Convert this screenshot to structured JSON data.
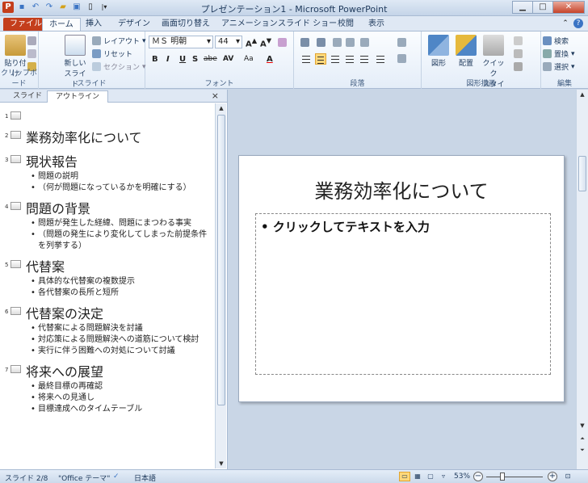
{
  "window": {
    "title": "プレゼンテーション1 - Microsoft PowerPoint",
    "minimize": "▁",
    "maximize": "□",
    "close": "✕"
  },
  "ribbon_tabs": [
    "ファイル",
    "ホーム",
    "挿入",
    "デザイン",
    "画面切り替え",
    "アニメーション",
    "スライド ショー",
    "校閲",
    "表示"
  ],
  "ribbon": {
    "clipboard": {
      "paste": "貼り付け",
      "label": "クリップボード"
    },
    "slides": {
      "new_slide_1": "新しい",
      "new_slide_2": "スライド",
      "layout": "レイアウト",
      "reset": "リセット",
      "section": "セクション",
      "label": "スライド"
    },
    "font": {
      "name": "ＭＳ 明朝",
      "size": "44",
      "label": "フォント",
      "bold": "B",
      "italic": "I",
      "underline": "U",
      "shadow": "S",
      "strike": "abe",
      "spacing": "AV",
      "case": "Aa",
      "color": "A"
    },
    "paragraph": {
      "label": "段落"
    },
    "drawing": {
      "shapes": "図形",
      "arrange": "配置",
      "quick_1": "クイック",
      "quick_2": "スタイル",
      "label": "図形描画"
    },
    "editing": {
      "find": "検索",
      "replace": "置換",
      "select": "選択",
      "label": "編集"
    }
  },
  "pane": {
    "tab_slides": "スライド",
    "tab_outline": "アウトライン",
    "close": "×"
  },
  "outline": [
    {
      "num": "1",
      "title": "",
      "bullets": []
    },
    {
      "num": "2",
      "title": "業務効率化について",
      "bullets": []
    },
    {
      "num": "3",
      "title": "現状報告",
      "bullets": [
        "問題の説明",
        "（何が問題になっているかを明確にする）"
      ]
    },
    {
      "num": "4",
      "title": "問題の背景",
      "bullets": [
        "問題が発生した経緯、問題にまつわる事実",
        "（問題の発生により変化してしまった前提条件を列挙する）"
      ]
    },
    {
      "num": "5",
      "title": "代替案",
      "bullets": [
        "具体的な代替案の複数提示",
        "各代替案の長所と短所"
      ]
    },
    {
      "num": "6",
      "title": "代替案の決定",
      "bullets": [
        "代替案による問題解決を討議",
        "対応策による問題解決への道筋について検討",
        "実行に伴う困難への対処について討議"
      ]
    },
    {
      "num": "7",
      "title": "将来への展望",
      "bullets": [
        "最終目標の再確認",
        "将来への見通し",
        "目標達成へのタイムテーブル"
      ]
    }
  ],
  "slide": {
    "title": "業務効率化について",
    "body": "• クリックしてテキストを入力"
  },
  "status": {
    "slide_info": "スライド 2/8",
    "theme": "\"Office テーマ\"",
    "language": "日本語",
    "zoom": "53%"
  }
}
